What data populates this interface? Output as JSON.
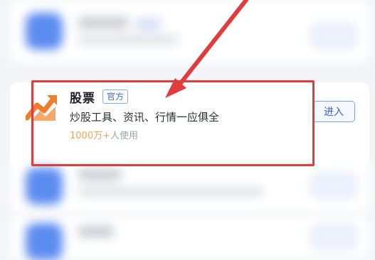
{
  "focused_app": {
    "name": "股票",
    "badge": "官方",
    "description": "炒股工具、资讯、行情一应俱全",
    "user_count": "1000万+",
    "user_suffix": "人使用",
    "enter_label": "进入",
    "icon": "stock-chart-icon"
  },
  "annotation": {
    "highlight_color": "#e23b3b",
    "arrow_color": "#e23b3b"
  },
  "colors": {
    "accent": "#2f63d6",
    "user_count": "#f0a35a",
    "icon_orange": "#ef7d2e"
  }
}
